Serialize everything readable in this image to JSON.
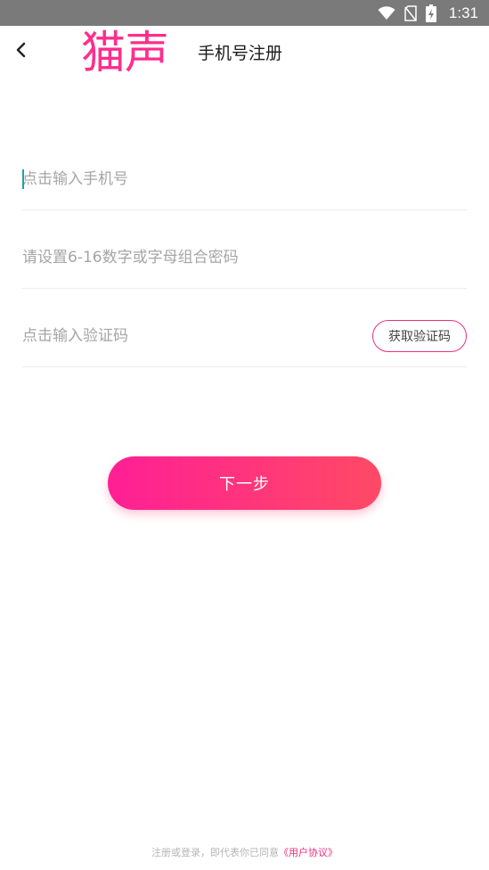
{
  "status_bar": {
    "time": "1:31",
    "icons": [
      "wifi-icon",
      "no-sim-icon",
      "battery-charging-icon"
    ]
  },
  "header": {
    "back_icon": "chevron-left-icon",
    "brand": "猫声",
    "title": "手机号注册"
  },
  "form": {
    "phone": {
      "placeholder": "点击输入手机号",
      "value": ""
    },
    "password": {
      "placeholder": "请设置6-16数字或字母组合密码",
      "value": ""
    },
    "code": {
      "placeholder": "点击输入验证码",
      "value": "",
      "button_label": "获取验证码"
    }
  },
  "next_button": {
    "label": "下一步"
  },
  "agreement": {
    "prefix": "注册或登录，即代表你已同意",
    "link": "《用户协议》"
  },
  "colors": {
    "accent": "#ff2d8c",
    "gradient_start": "#ff1f95",
    "gradient_end": "#ff4a65",
    "status_bar": "#7a7a7a"
  }
}
